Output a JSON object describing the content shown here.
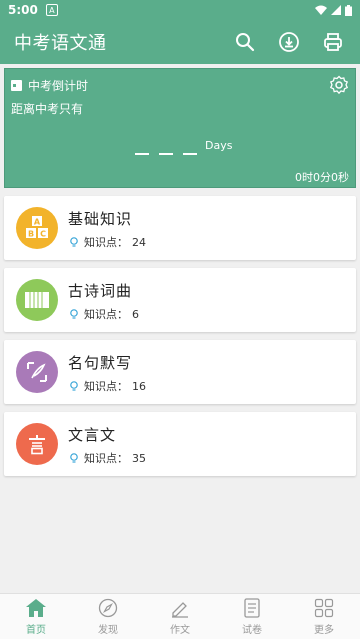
{
  "statusbar": {
    "time": "5:00",
    "badge": "A"
  },
  "appbar": {
    "title": "中考语文通",
    "actions": [
      "search-icon",
      "download-icon",
      "print-icon"
    ]
  },
  "countdown": {
    "header": "中考倒计时",
    "subtitle": "距离中考只有",
    "days_label": "Days",
    "time_remaining": "0时0分0秒"
  },
  "categories": [
    {
      "title": "基础知识",
      "meta_label": "知识点：",
      "count": "24",
      "color": "#f2b32b",
      "icon": "abc-blocks-icon"
    },
    {
      "title": "古诗词曲",
      "meta_label": "知识点：",
      "count": "6",
      "color": "#8ec95a",
      "icon": "scroll-icon"
    },
    {
      "title": "名句默写",
      "meta_label": "知识点：",
      "count": "16",
      "color": "#a97ab8",
      "icon": "quill-icon"
    },
    {
      "title": "文言文",
      "meta_label": "知识点：",
      "count": "35",
      "color": "#ee6a4d",
      "icon": "seal-icon"
    }
  ],
  "tabs": [
    {
      "label": "首页",
      "icon": "home-icon",
      "active": true
    },
    {
      "label": "发现",
      "icon": "compass-icon",
      "active": false
    },
    {
      "label": "作文",
      "icon": "pencil-icon",
      "active": false
    },
    {
      "label": "试卷",
      "icon": "paper-icon",
      "active": false
    },
    {
      "label": "更多",
      "icon": "grid-icon",
      "active": false
    }
  ],
  "colors": {
    "primary": "#5aad8b",
    "inactive": "#999999"
  }
}
